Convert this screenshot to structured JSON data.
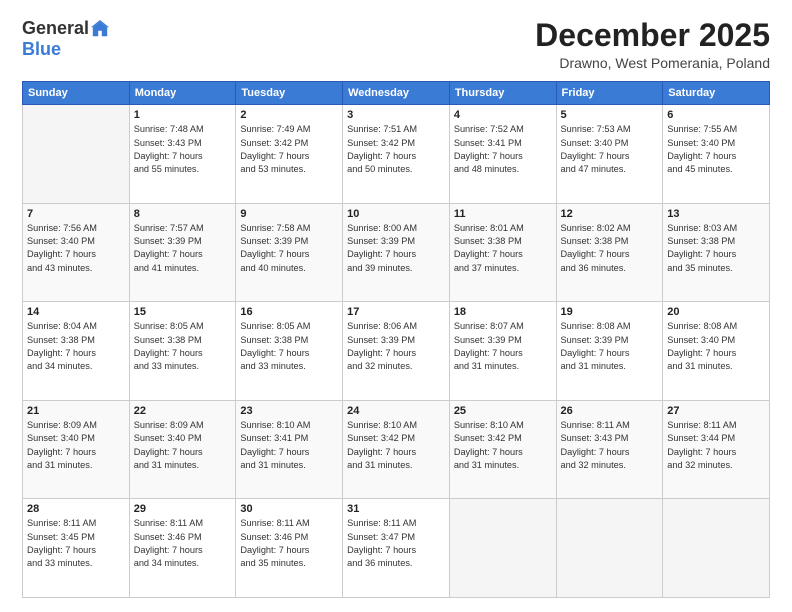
{
  "header": {
    "logo_general": "General",
    "logo_blue": "Blue",
    "month_title": "December 2025",
    "subtitle": "Drawno, West Pomerania, Poland"
  },
  "days_of_week": [
    "Sunday",
    "Monday",
    "Tuesday",
    "Wednesday",
    "Thursday",
    "Friday",
    "Saturday"
  ],
  "weeks": [
    [
      {
        "day": "",
        "info": ""
      },
      {
        "day": "1",
        "info": "Sunrise: 7:48 AM\nSunset: 3:43 PM\nDaylight: 7 hours\nand 55 minutes."
      },
      {
        "day": "2",
        "info": "Sunrise: 7:49 AM\nSunset: 3:42 PM\nDaylight: 7 hours\nand 53 minutes."
      },
      {
        "day": "3",
        "info": "Sunrise: 7:51 AM\nSunset: 3:42 PM\nDaylight: 7 hours\nand 50 minutes."
      },
      {
        "day": "4",
        "info": "Sunrise: 7:52 AM\nSunset: 3:41 PM\nDaylight: 7 hours\nand 48 minutes."
      },
      {
        "day": "5",
        "info": "Sunrise: 7:53 AM\nSunset: 3:40 PM\nDaylight: 7 hours\nand 47 minutes."
      },
      {
        "day": "6",
        "info": "Sunrise: 7:55 AM\nSunset: 3:40 PM\nDaylight: 7 hours\nand 45 minutes."
      }
    ],
    [
      {
        "day": "7",
        "info": "Sunrise: 7:56 AM\nSunset: 3:40 PM\nDaylight: 7 hours\nand 43 minutes."
      },
      {
        "day": "8",
        "info": "Sunrise: 7:57 AM\nSunset: 3:39 PM\nDaylight: 7 hours\nand 41 minutes."
      },
      {
        "day": "9",
        "info": "Sunrise: 7:58 AM\nSunset: 3:39 PM\nDaylight: 7 hours\nand 40 minutes."
      },
      {
        "day": "10",
        "info": "Sunrise: 8:00 AM\nSunset: 3:39 PM\nDaylight: 7 hours\nand 39 minutes."
      },
      {
        "day": "11",
        "info": "Sunrise: 8:01 AM\nSunset: 3:38 PM\nDaylight: 7 hours\nand 37 minutes."
      },
      {
        "day": "12",
        "info": "Sunrise: 8:02 AM\nSunset: 3:38 PM\nDaylight: 7 hours\nand 36 minutes."
      },
      {
        "day": "13",
        "info": "Sunrise: 8:03 AM\nSunset: 3:38 PM\nDaylight: 7 hours\nand 35 minutes."
      }
    ],
    [
      {
        "day": "14",
        "info": "Sunrise: 8:04 AM\nSunset: 3:38 PM\nDaylight: 7 hours\nand 34 minutes."
      },
      {
        "day": "15",
        "info": "Sunrise: 8:05 AM\nSunset: 3:38 PM\nDaylight: 7 hours\nand 33 minutes."
      },
      {
        "day": "16",
        "info": "Sunrise: 8:05 AM\nSunset: 3:38 PM\nDaylight: 7 hours\nand 33 minutes."
      },
      {
        "day": "17",
        "info": "Sunrise: 8:06 AM\nSunset: 3:39 PM\nDaylight: 7 hours\nand 32 minutes."
      },
      {
        "day": "18",
        "info": "Sunrise: 8:07 AM\nSunset: 3:39 PM\nDaylight: 7 hours\nand 31 minutes."
      },
      {
        "day": "19",
        "info": "Sunrise: 8:08 AM\nSunset: 3:39 PM\nDaylight: 7 hours\nand 31 minutes."
      },
      {
        "day": "20",
        "info": "Sunrise: 8:08 AM\nSunset: 3:40 PM\nDaylight: 7 hours\nand 31 minutes."
      }
    ],
    [
      {
        "day": "21",
        "info": "Sunrise: 8:09 AM\nSunset: 3:40 PM\nDaylight: 7 hours\nand 31 minutes."
      },
      {
        "day": "22",
        "info": "Sunrise: 8:09 AM\nSunset: 3:40 PM\nDaylight: 7 hours\nand 31 minutes."
      },
      {
        "day": "23",
        "info": "Sunrise: 8:10 AM\nSunset: 3:41 PM\nDaylight: 7 hours\nand 31 minutes."
      },
      {
        "day": "24",
        "info": "Sunrise: 8:10 AM\nSunset: 3:42 PM\nDaylight: 7 hours\nand 31 minutes."
      },
      {
        "day": "25",
        "info": "Sunrise: 8:10 AM\nSunset: 3:42 PM\nDaylight: 7 hours\nand 31 minutes."
      },
      {
        "day": "26",
        "info": "Sunrise: 8:11 AM\nSunset: 3:43 PM\nDaylight: 7 hours\nand 32 minutes."
      },
      {
        "day": "27",
        "info": "Sunrise: 8:11 AM\nSunset: 3:44 PM\nDaylight: 7 hours\nand 32 minutes."
      }
    ],
    [
      {
        "day": "28",
        "info": "Sunrise: 8:11 AM\nSunset: 3:45 PM\nDaylight: 7 hours\nand 33 minutes."
      },
      {
        "day": "29",
        "info": "Sunrise: 8:11 AM\nSunset: 3:46 PM\nDaylight: 7 hours\nand 34 minutes."
      },
      {
        "day": "30",
        "info": "Sunrise: 8:11 AM\nSunset: 3:46 PM\nDaylight: 7 hours\nand 35 minutes."
      },
      {
        "day": "31",
        "info": "Sunrise: 8:11 AM\nSunset: 3:47 PM\nDaylight: 7 hours\nand 36 minutes."
      },
      {
        "day": "",
        "info": ""
      },
      {
        "day": "",
        "info": ""
      },
      {
        "day": "",
        "info": ""
      }
    ]
  ]
}
